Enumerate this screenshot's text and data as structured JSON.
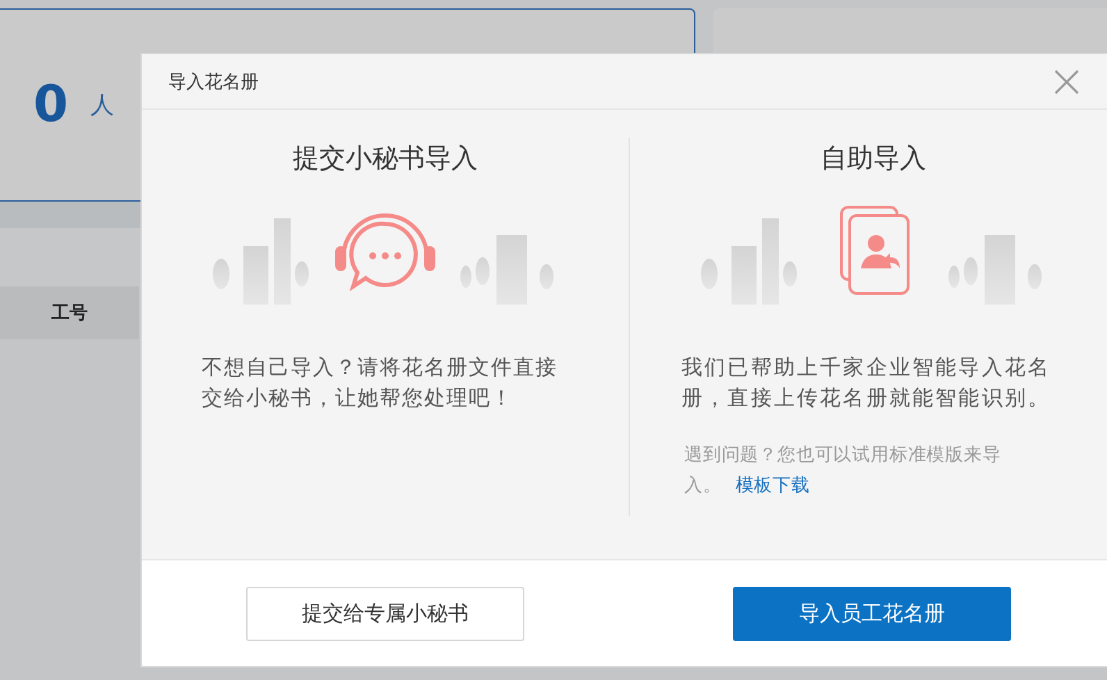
{
  "background": {
    "count": "0",
    "unit": "人",
    "column_header": "工号"
  },
  "dialog": {
    "title": "导入花名册",
    "options": [
      {
        "kind": "secretary",
        "heading": "提交小秘书导入",
        "description": "不想自己导入？请将花名册文件直接交给小秘书，让她帮您处理吧！"
      },
      {
        "kind": "self",
        "heading": "自助导入",
        "description": "我们已帮助上千家企业智能导入花名册，直接上传花名册就能智能识别。",
        "hint": "遇到问题？您也可以试用标准模版来导入。",
        "link": "模板下载"
      }
    ],
    "buttons": [
      {
        "label": "提交给专属小秘书",
        "primary": false
      },
      {
        "label": "导入员工花名册",
        "primary": true
      }
    ]
  }
}
